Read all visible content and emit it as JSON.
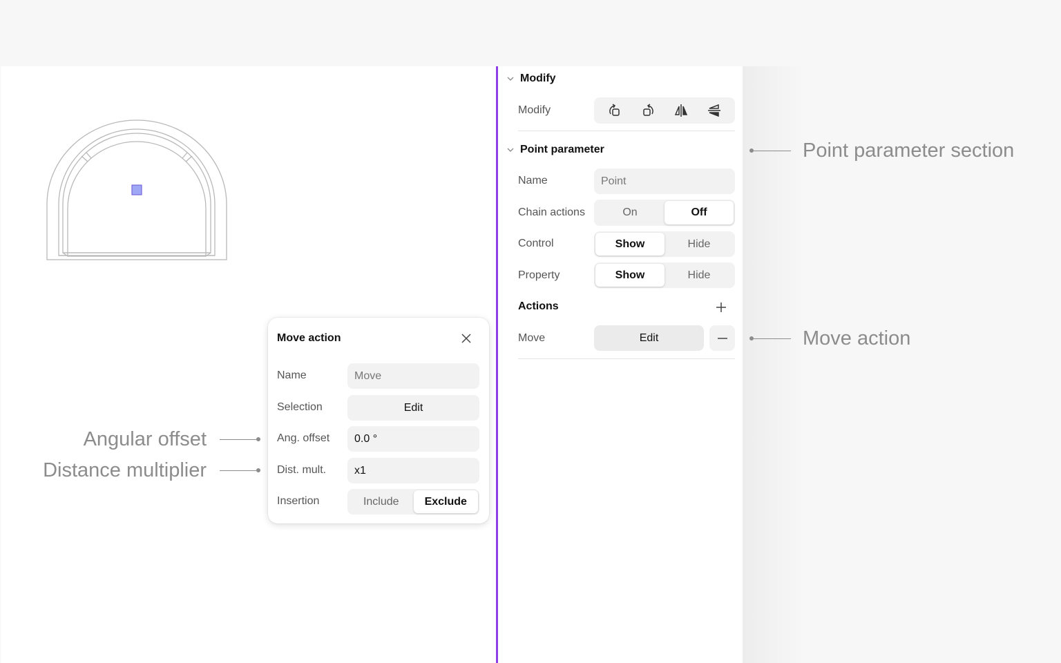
{
  "colors": {
    "accent": "#8e3ee6",
    "handle_fill": "#9fa8f5",
    "handle_stroke": "#7766dd",
    "annotation": "#8c8c8c"
  },
  "panel": {
    "modify_section": {
      "title": "Modify",
      "row_label": "Modify",
      "icons": [
        "rotate-ccw-icon",
        "rotate-cw-icon",
        "flip-horizontal-icon",
        "flip-vertical-icon"
      ]
    },
    "point_section": {
      "title": "Point parameter",
      "name_label": "Name",
      "name_placeholder": "Point",
      "chain_label": "Chain actions",
      "chain_options": [
        "On",
        "Off"
      ],
      "chain_selected": "Off",
      "control_label": "Control",
      "control_options": [
        "Show",
        "Hide"
      ],
      "control_selected": "Show",
      "property_label": "Property",
      "property_options": [
        "Show",
        "Hide"
      ],
      "property_selected": "Show",
      "actions_label": "Actions",
      "move_label": "Move",
      "move_edit": "Edit"
    }
  },
  "popup": {
    "title": "Move action",
    "name_label": "Name",
    "name_placeholder": "Move",
    "selection_label": "Selection",
    "selection_button": "Edit",
    "ang_offset_label": "Ang. offset",
    "ang_offset_value": "0.0 °",
    "dist_mult_label": "Dist. mult.",
    "dist_mult_value": "x1",
    "insertion_label": "Insertion",
    "insertion_options": [
      "Include",
      "Exclude"
    ],
    "insertion_selected": "Exclude"
  },
  "annotations": {
    "point_parameter_section": "Point parameter section",
    "move_action": "Move action",
    "angular_offset": "Angular offset",
    "distance_multiplier": "Distance multiplier"
  }
}
